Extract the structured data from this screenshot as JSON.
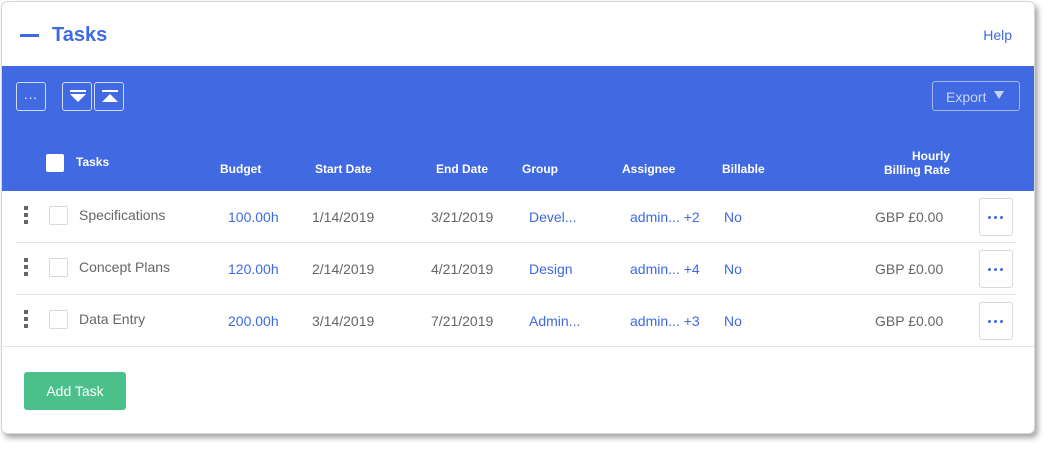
{
  "header": {
    "title": "Tasks",
    "help_label": "Help"
  },
  "toolbar": {
    "more_label": "...",
    "export_label": "Export",
    "expand_icon": "expand-all-icon",
    "collapse_icon": "collapse-all-icon"
  },
  "columns": {
    "tasks": "Tasks",
    "budget": "Budget",
    "start_date": "Start Date",
    "end_date": "End Date",
    "group": "Group",
    "assignee": "Assignee",
    "billable": "Billable",
    "hourly_line1": "Hourly",
    "hourly_line2": "Billing Rate"
  },
  "rows": [
    {
      "name": "Specifications",
      "budget": "100.00h",
      "start": "1/14/2019",
      "end": "3/21/2019",
      "group": "Devel...",
      "assignee": "admin... +2",
      "billable": "No",
      "rate": "GBP £0.00"
    },
    {
      "name": "Concept Plans",
      "budget": "120.00h",
      "start": "2/14/2019",
      "end": "4/21/2019",
      "group": "Design",
      "assignee": "admin... +4",
      "billable": "No",
      "rate": "GBP £0.00"
    },
    {
      "name": "Data Entry",
      "budget": "200.00h",
      "start": "3/14/2019",
      "end": "7/21/2019",
      "group": "Admin...",
      "assignee": "admin... +3",
      "billable": "No",
      "rate": "GBP £0.00"
    }
  ],
  "footer": {
    "add_label": "Add Task"
  },
  "colors": {
    "accent": "#4169e1",
    "link": "#3e6ae1",
    "add_button": "#4cc08a"
  }
}
